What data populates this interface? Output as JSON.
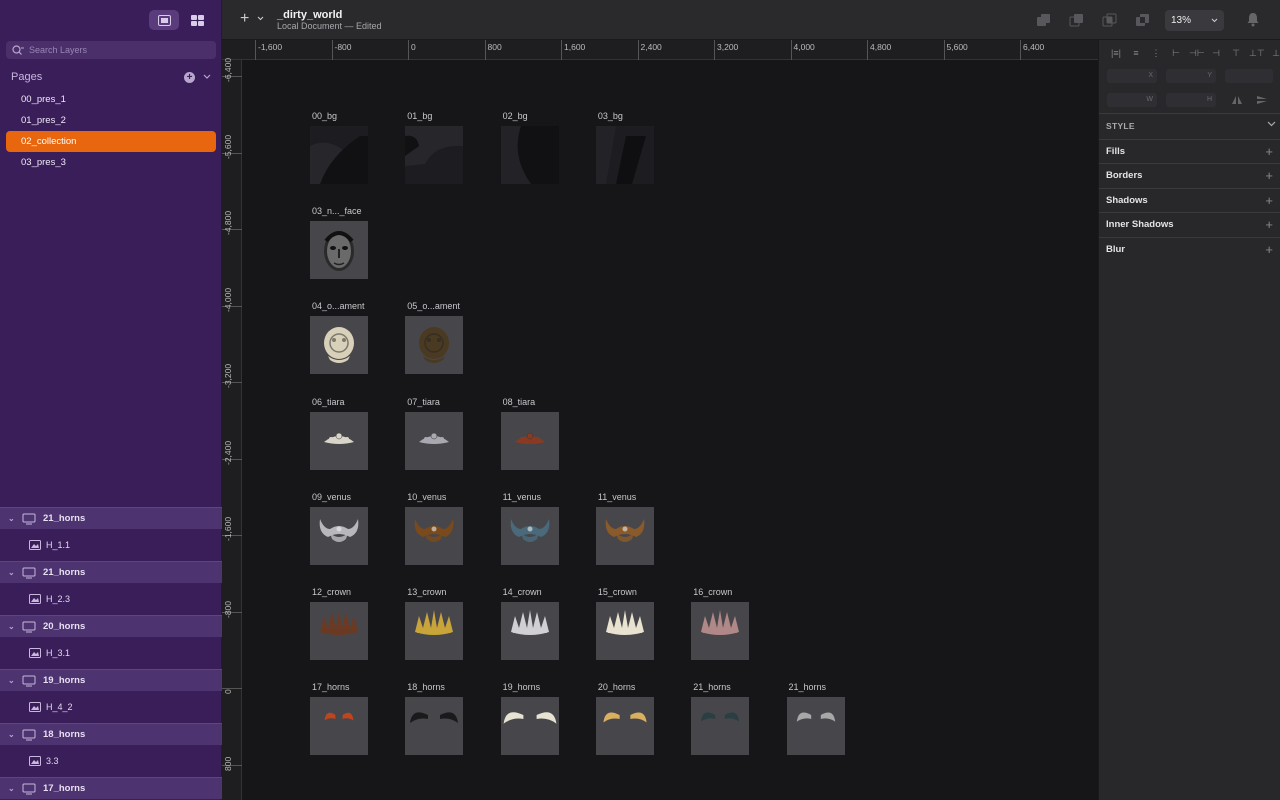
{
  "document": {
    "title": "_dirty_world",
    "subtitle": "Local Document — Edited"
  },
  "search": {
    "placeholder": "Search Layers"
  },
  "pages": {
    "header": "Pages",
    "items": [
      {
        "label": "00_pres_1",
        "selected": false
      },
      {
        "label": "01_pres_2",
        "selected": false
      },
      {
        "label": "02_collection",
        "selected": true
      },
      {
        "label": "03_pres_3",
        "selected": false
      }
    ]
  },
  "layers": [
    {
      "group": "21_horns",
      "child": "H_1.1"
    },
    {
      "group": "21_horns",
      "child": "H_2.3"
    },
    {
      "group": "20_horns",
      "child": "H_3.1"
    },
    {
      "group": "19_horns",
      "child": "H_4_2"
    },
    {
      "group": "18_horns",
      "child": "3.3"
    },
    {
      "group": "17_horns",
      "child": ""
    }
  ],
  "toolbar": {
    "zoom": "13%"
  },
  "ruler_h": [
    "-1,600",
    "-800",
    "0",
    "800",
    "1,600",
    "2,400",
    "3,200",
    "4,000",
    "4,800",
    "5,600",
    "6,400"
  ],
  "ruler_v": [
    "-6,400",
    "-5,600",
    "-4,800",
    "-4,000",
    "-3,200",
    "-2,400",
    "-1,600",
    "-800",
    "0",
    "800"
  ],
  "inspector": {
    "fields": {
      "x": "X",
      "y": "Y",
      "w": "W",
      "h": "H"
    },
    "style_header": "STYLE",
    "properties": [
      "Fills",
      "Borders",
      "Shadows",
      "Inner Shadows",
      "Blur"
    ]
  },
  "artboards": [
    {
      "label": "00_bg",
      "kind": "bg",
      "variant": 0
    },
    {
      "label": "01_bg",
      "kind": "bg",
      "variant": 1
    },
    {
      "label": "02_bg",
      "kind": "bg",
      "variant": 2
    },
    {
      "label": "03_bg",
      "kind": "bg",
      "variant": 3
    },
    {
      "label": "03_n..._face",
      "kind": "face"
    },
    {
      "label": "04_o...ament",
      "kind": "ornament",
      "color": "#d8d0b8"
    },
    {
      "label": "05_o...ament",
      "kind": "ornament",
      "color": "#4a3a22"
    },
    {
      "label": "06_tiara",
      "kind": "tiara",
      "color": "#d8d4c8"
    },
    {
      "label": "07_tiara",
      "kind": "tiara",
      "color": "#a8a8b0"
    },
    {
      "label": "08_tiara",
      "kind": "tiara",
      "color": "#8a3a22"
    },
    {
      "label": "09_venus",
      "kind": "venus",
      "color": "#b8b8bc"
    },
    {
      "label": "10_venus",
      "kind": "venus",
      "color": "#7a4a1c"
    },
    {
      "label": "11_venus",
      "kind": "venus",
      "color": "#4a6a7c"
    },
    {
      "label": "11_venus",
      "kind": "venus",
      "color": "#8a5a2a"
    },
    {
      "label": "12_crown",
      "kind": "crown",
      "color": "#6a3a24"
    },
    {
      "label": "13_crown",
      "kind": "crown",
      "color": "#c8a43a"
    },
    {
      "label": "14_crown",
      "kind": "crown",
      "color": "#d0d0d4"
    },
    {
      "label": "15_crown",
      "kind": "crown",
      "color": "#e8e2d0"
    },
    {
      "label": "16_crown",
      "kind": "crown",
      "color": "#b08888"
    },
    {
      "label": "17_horns",
      "kind": "horns",
      "color": "#c0441e",
      "size": 0.6
    },
    {
      "label": "18_horns",
      "kind": "horns",
      "color": "#1a1a1c",
      "size": 1
    },
    {
      "label": "19_horns",
      "kind": "horns",
      "color": "#e8e2d2",
      "size": 1.1
    },
    {
      "label": "20_horns",
      "kind": "horns",
      "color": "#d8b060",
      "size": 0.9
    },
    {
      "label": "21_horns",
      "kind": "horns",
      "color": "#2a3e44",
      "size": 0.8
    },
    {
      "label": "21_horns",
      "kind": "horns",
      "color": "#a8a8a8",
      "size": 0.8
    }
  ]
}
